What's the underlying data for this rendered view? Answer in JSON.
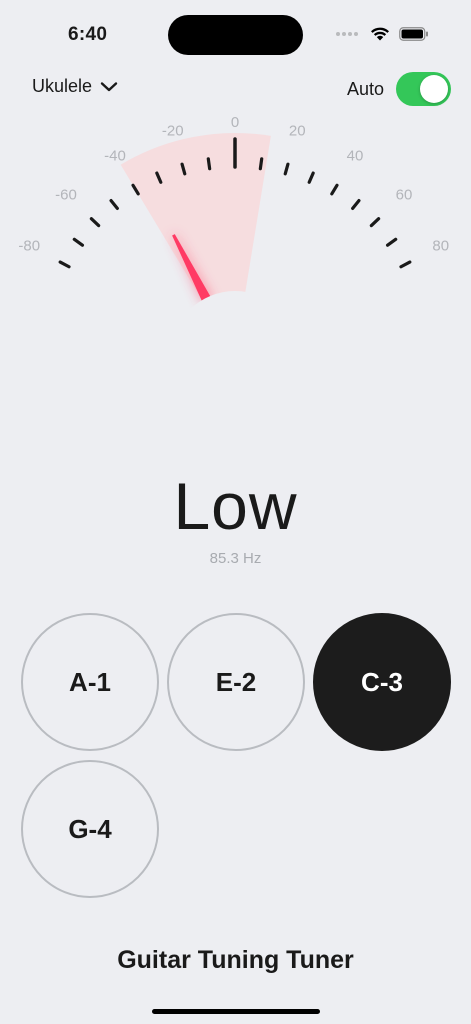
{
  "status_bar": {
    "time": "6:40"
  },
  "header": {
    "instrument": "Ukulele",
    "auto_label": "Auto",
    "auto_enabled": true
  },
  "gauge": {
    "min": -80,
    "max": 80,
    "tick_labels": [
      "-80",
      "-60",
      "-40",
      "-20",
      "0",
      "20",
      "40",
      "60",
      "80"
    ],
    "needle_value": -35,
    "highlight_range": [
      -40,
      12
    ],
    "needle_color": "#ff3b64",
    "highlight_color": "#f7d9dc"
  },
  "reading": {
    "status": "Low",
    "frequency": "85.3 Hz"
  },
  "strings": [
    {
      "label": "A-1",
      "selected": false
    },
    {
      "label": "E-2",
      "selected": false
    },
    {
      "label": "C-3",
      "selected": true
    },
    {
      "label": "G-4",
      "selected": false
    }
  ],
  "footer": {
    "title": "Guitar Tuning Tuner"
  }
}
